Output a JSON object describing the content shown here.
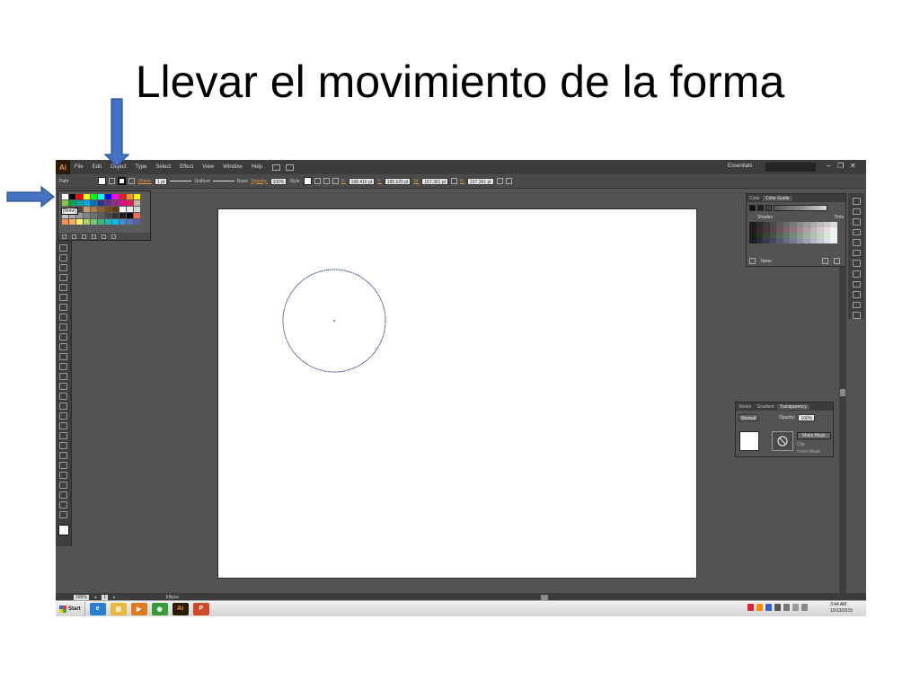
{
  "slide": {
    "title": "Llevar el movimiento de la forma"
  },
  "app": {
    "logo": "Ai",
    "menus": [
      "File",
      "Edit",
      "Object",
      "Type",
      "Select",
      "Effect",
      "View",
      "Window",
      "Help"
    ],
    "workspace": "Essentials",
    "window_controls": {
      "minimize": "–",
      "restore": "❐",
      "close": "✕"
    }
  },
  "control_bar": {
    "selection_label": "Path",
    "stroke_link": "Stroke:",
    "stroke_weight": "1 pt",
    "profile": "Uniform",
    "brush": "Basic",
    "opacity_link": "Opacity:",
    "opacity_value": "100%",
    "style_label": "Style:",
    "x_label": "X:",
    "x_value": "198.416 pt",
    "y_label": "Y:",
    "y_value": "185.525 pt",
    "w_label": "W:",
    "w_value": "157.361 pt",
    "h_label": "H:",
    "h_value": "157.361 pt"
  },
  "swatch_popup": {
    "tooltip": "[None]",
    "colors": [
      "#ffffff",
      "#000000",
      "#ff0000",
      "#ffff00",
      "#00ff00",
      "#00ffff",
      "#0000ff",
      "#ff00ff",
      "#e31b23",
      "#f7941d",
      "#fff200",
      "#8dc63f",
      "#00a651",
      "#00a99d",
      "#00aeef",
      "#0072bc",
      "#2e3192",
      "#662d91",
      "#92278f",
      "#ec008c",
      "#ed145b",
      "#c7b299",
      "#998675",
      "#736357",
      "#534741",
      "#c69c6d",
      "#a67c52",
      "#8c6239",
      "#754c24",
      "#603913",
      "#ffffff",
      "#ebebeb",
      "#d6d6d6",
      "#c2c2c2",
      "#adadad",
      "#999999",
      "#858585",
      "#707070",
      "#5c5c5c",
      "#474747",
      "#333333",
      "#1e1e1e",
      "#000000",
      "#f26c4f",
      "#f68e56",
      "#fbaf5d",
      "#fff568",
      "#acd373",
      "#7cc576",
      "#3bb878",
      "#1abbb4",
      "#00bff3",
      "#438ccb",
      "#5574b9",
      "#605ca8"
    ]
  },
  "color_guide": {
    "tabs": [
      "Color",
      "Color Guide"
    ],
    "shades_label": "Shades",
    "tints_label": "Tints",
    "footer_label": "None",
    "grid_colors": [
      "#1c1c1c",
      "#2a2a2a",
      "#3a3a3a",
      "#4a4a4a",
      "#5a5a5a",
      "#6a6a6a",
      "#7a7a7a",
      "#8a8a8a",
      "#9a9a9a",
      "#aaaaaa",
      "#bababa",
      "#cacaca",
      "#dadada",
      "#241a1e",
      "#352830",
      "#46353f",
      "#574350",
      "#69525f",
      "#7b6370",
      "#8d7582",
      "#9f8894",
      "#b19ca7",
      "#c3b1bb",
      "#d4c6ce",
      "#e4dbe0",
      "#f2eef0",
      "#1a2118",
      "#283227",
      "#364435",
      "#455545",
      "#556756",
      "#667968",
      "#788b7a",
      "#8a9d8c",
      "#9daf9f",
      "#b0c1b2",
      "#c4d2c5",
      "#d8e3d9",
      "#ecf2ec",
      "#1a1c26",
      "#282b38",
      "#363a4b",
      "#45495d",
      "#565a70",
      "#686c82",
      "#7a7e94",
      "#8d91a6",
      "#a0a4b7",
      "#b4b7c8",
      "#c8cad8",
      "#dcdee7",
      "#eef0f5"
    ]
  },
  "transparency_panel": {
    "tabs": [
      "Stroke",
      "Gradient",
      "Transparency"
    ],
    "blend_mode": "Normal",
    "opacity_label": "Opacity:",
    "opacity_value": "100%",
    "make_mask": "Make Mask",
    "clip": "Clip",
    "invert_mask": "Invert Mask"
  },
  "status_bar": {
    "zoom": "100%",
    "page": "1",
    "tool_name": "Ellipse"
  },
  "taskbar": {
    "start": "Start",
    "time": "3:44 AM",
    "date": "10/13/2015",
    "apps": [
      {
        "name": "ie",
        "glyph": "e",
        "color": "#2a7fd4"
      },
      {
        "name": "folder",
        "glyph": "▤",
        "color": "#e8b838"
      },
      {
        "name": "media",
        "glyph": "▶",
        "color": "#e07820"
      },
      {
        "name": "chrome",
        "glyph": "◉",
        "color": "#3a9a3a"
      },
      {
        "name": "illustrator",
        "glyph": "Ai",
        "color": "#2a1a08"
      },
      {
        "name": "powerpoint",
        "glyph": "P",
        "color": "#d24726"
      }
    ]
  },
  "colors": {
    "ellipse_stroke": "#2b3d8f",
    "arrow_fill": "#4472c4",
    "arrow_stroke": "#2f528f"
  }
}
